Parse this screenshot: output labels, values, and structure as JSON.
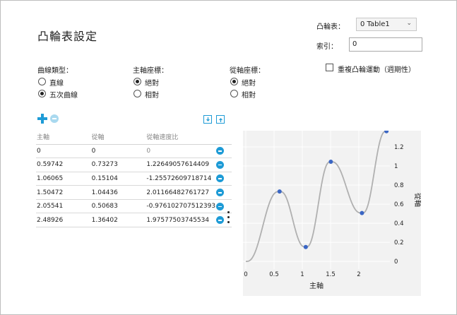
{
  "page": {
    "title": "凸輪表設定"
  },
  "cam_table": {
    "label": "凸輪表：",
    "selected": "0 Table1"
  },
  "index": {
    "label": "索引：",
    "value": "0"
  },
  "repeat": {
    "label": "重複凸輪運動（週期性）",
    "checked": false
  },
  "curve_type": {
    "label": "曲線類型：",
    "options": [
      {
        "label": "直線",
        "selected": false
      },
      {
        "label": "五次曲線",
        "selected": true
      }
    ]
  },
  "master_coord": {
    "label": "主軸座標：",
    "options": [
      {
        "label": "絕對",
        "selected": true
      },
      {
        "label": "相對",
        "selected": false
      }
    ]
  },
  "slave_coord": {
    "label": "從軸座標：",
    "options": [
      {
        "label": "絕對",
        "selected": true
      },
      {
        "label": "相對",
        "selected": false
      }
    ]
  },
  "table": {
    "headers": [
      "主軸",
      "從軸",
      "從軸速度比"
    ],
    "rows": [
      [
        "0",
        "0",
        "0"
      ],
      [
        "0.59742",
        "0.73273",
        "1.22649057614409"
      ],
      [
        "1.06065",
        "0.15104",
        "-1.25572609718714"
      ],
      [
        "1.50472",
        "1.04436",
        "2.01166482761727"
      ],
      [
        "2.05541",
        "0.50683",
        "-0.976102707512393"
      ],
      [
        "2.48926",
        "1.36402",
        "1.97577503745534"
      ]
    ]
  },
  "colors": {
    "accent": "#1e9bd6",
    "curve": "#b0b0b0",
    "point": "#3a66c4",
    "chart_bg": "#f2f2f2"
  },
  "chart_data": {
    "type": "line",
    "xlabel": "主軸",
    "ylabel": "從軸",
    "x": [
      0,
      0.59742,
      1.06065,
      1.50472,
      2.05541,
      2.48926
    ],
    "y": [
      0,
      0.73273,
      0.15104,
      1.04436,
      0.50683,
      1.36402
    ],
    "xlim": [
      -0.05,
      2.55
    ],
    "ylim": [
      -0.08,
      1.37
    ],
    "xticks": [
      "0",
      "0.5",
      "1",
      "1.5",
      "2"
    ],
    "yticks": [
      "0",
      "0.2",
      "0.4",
      "0.6",
      "0.8",
      "1",
      "1.2"
    ],
    "grid": true
  }
}
